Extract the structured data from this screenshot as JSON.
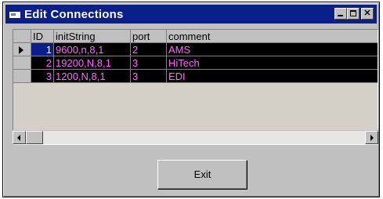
{
  "window": {
    "title": "Edit Connections",
    "controls": [
      "minimize-icon",
      "maximize-icon",
      "close-icon"
    ]
  },
  "grid": {
    "columns": [
      "ID",
      "initString",
      "port",
      "comment"
    ],
    "rows": [
      {
        "id": "1",
        "initString": "9600,n,8,1",
        "port": "2",
        "comment": "AMS",
        "current": true
      },
      {
        "id": "2",
        "initString": "19200,N,8,1",
        "port": "3",
        "comment": "HiTech",
        "current": false
      },
      {
        "id": "3",
        "initString": "1200,N,8,1",
        "port": "3",
        "comment": "EDI",
        "current": false
      }
    ]
  },
  "footer": {
    "exit_label": "Exit"
  },
  "colors": {
    "titlebar": "#0a1f8a",
    "row_background": "#000000",
    "row_text": "#ff66ff",
    "face": "#c0c0c0"
  }
}
